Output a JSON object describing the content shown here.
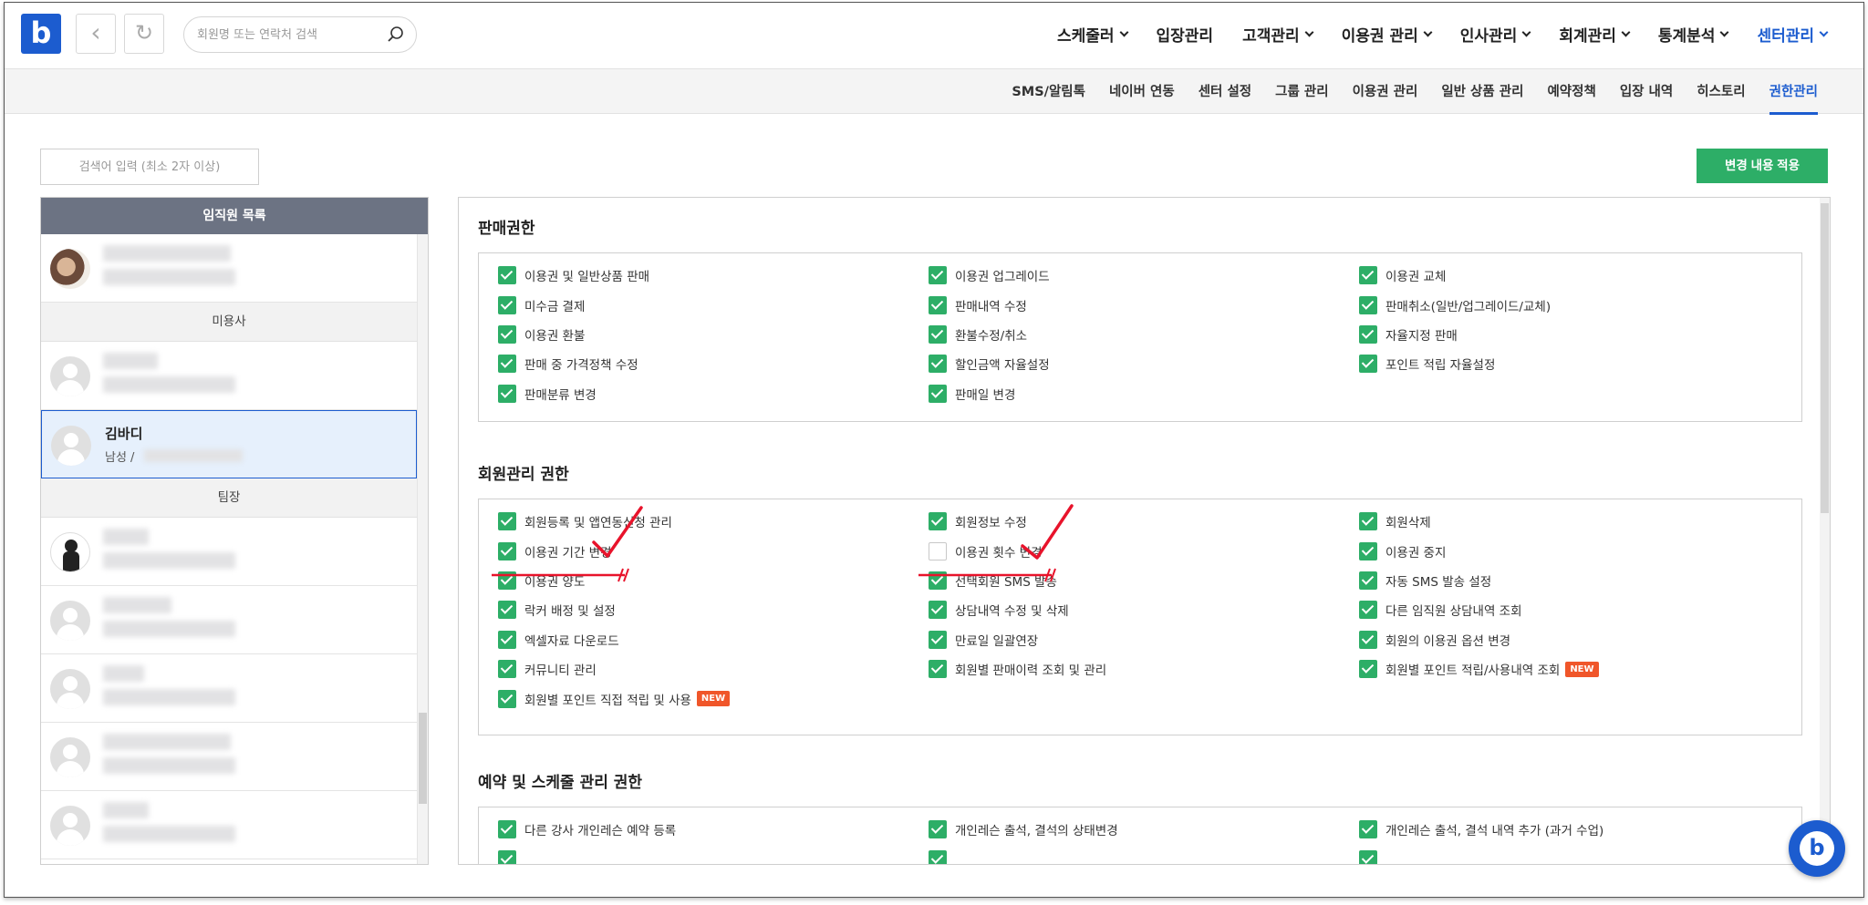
{
  "header": {
    "logo": "b",
    "search_placeholder": "회원명 또는 연락처 검색",
    "nav": [
      "스케줄러",
      "입장관리",
      "고객관리",
      "이용권 관리",
      "인사관리",
      "회계관리",
      "통계분석",
      "센터관리"
    ]
  },
  "subnav": [
    "SMS/알림톡",
    "네이버 연동",
    "센터 설정",
    "그룹 관리",
    "이용권 관리",
    "일반 상품 관리",
    "예약정책",
    "입장 내역",
    "히스토리",
    "권한관리"
  ],
  "staff_search_placeholder": "검색어 입력 (최소 2자 이상)",
  "apply_button": "변경 내용 적용",
  "staff_list": {
    "title": "임직원 목록",
    "groups": [
      {
        "label": "미용사"
      },
      {
        "label": "팀장"
      }
    ],
    "selected": {
      "name": "김바디",
      "sub": "남성 /"
    }
  },
  "sections": [
    {
      "title": "판매권한",
      "perms": [
        {
          "label": "이용권 및 일반상품 판매",
          "checked": true
        },
        {
          "label": "이용권 업그레이드",
          "checked": true
        },
        {
          "label": "이용권 교체",
          "checked": true
        },
        {
          "label": "미수금 결제",
          "checked": true
        },
        {
          "label": "판매내역 수정",
          "checked": true
        },
        {
          "label": "판매취소(일반/업그레이드/교체)",
          "checked": true
        },
        {
          "label": "이용권 환불",
          "checked": true
        },
        {
          "label": "환불수정/취소",
          "checked": true
        },
        {
          "label": "자율지정 판매",
          "checked": true
        },
        {
          "label": "판매 중 가격정책 수정",
          "checked": true
        },
        {
          "label": "할인금액 자율설정",
          "checked": true
        },
        {
          "label": "포인트 적립 자율설정",
          "checked": true
        },
        {
          "label": "판매분류 변경",
          "checked": true
        },
        {
          "label": "판매일 변경",
          "checked": true
        }
      ]
    },
    {
      "title": "회원관리 권한",
      "perms": [
        {
          "label": "회원등록 및 앱연동신청 관리",
          "checked": true
        },
        {
          "label": "회원정보 수정",
          "checked": true
        },
        {
          "label": "회원삭제",
          "checked": true
        },
        {
          "label": "이용권 기간 변경",
          "checked": true
        },
        {
          "label": "이용권 횟수 변경",
          "checked": false
        },
        {
          "label": "이용권 중지",
          "checked": true
        },
        {
          "label": "이용권 양도",
          "checked": true
        },
        {
          "label": "선택회원 SMS 발송",
          "checked": true
        },
        {
          "label": "자동 SMS 발송 설정",
          "checked": true
        },
        {
          "label": "락커 배정 및 설정",
          "checked": true
        },
        {
          "label": "상담내역 수정 및 삭제",
          "checked": true
        },
        {
          "label": "다른 임직원 상담내역 조회",
          "checked": true
        },
        {
          "label": "엑셀자료 다운로드",
          "checked": true
        },
        {
          "label": "만료일 일괄연장",
          "checked": true
        },
        {
          "label": "회원의 이용권 옵션 변경",
          "checked": true
        },
        {
          "label": "커뮤니티 관리",
          "checked": true
        },
        {
          "label": "회원별 판매이력 조회 및 관리",
          "checked": true
        },
        {
          "label": "회원별 포인트 적립/사용내역 조회",
          "checked": true,
          "badge": "NEW"
        },
        {
          "label": "회원별 포인트 직접 적립 및 사용",
          "checked": true,
          "badge": "NEW"
        }
      ]
    },
    {
      "title": "예약 및 스케줄 관리 권한",
      "perms": [
        {
          "label": "다른 강사 개인레슨 예약 등록",
          "checked": true
        },
        {
          "label": "개인레슨 출석, 결석의 상태변경",
          "checked": true
        },
        {
          "label": "개인레슨 출석, 결석 내역 추가 (과거 수업)",
          "checked": true
        },
        {
          "label": "",
          "checked": true
        },
        {
          "label": "",
          "checked": true
        },
        {
          "label": "",
          "checked": true
        }
      ]
    }
  ],
  "colors": {
    "brand": "#1c5ccf",
    "check": "#2dae67",
    "annotation": "#e8132b",
    "badge": "#f0562a"
  }
}
